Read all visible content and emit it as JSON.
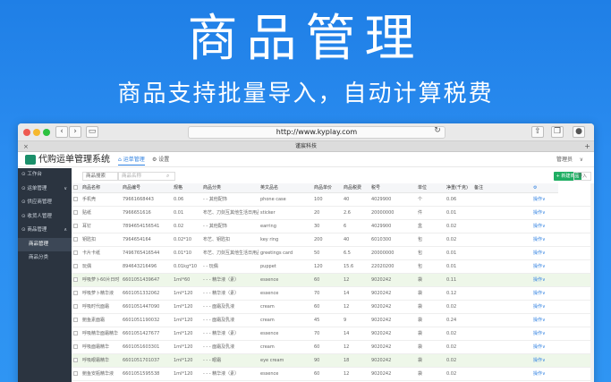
{
  "hero": {
    "title": "商品管理",
    "subtitle": "商品支持批量导入，自动计算税费"
  },
  "browser": {
    "url": "http://www.kyplay.com",
    "tab_title": "谨宸科技"
  },
  "app": {
    "logo_text": "代购运单管理系统",
    "tabs": [
      "运单管理",
      "设置"
    ],
    "user": "管理员"
  },
  "sidebar": {
    "items": [
      {
        "label": "工作台",
        "caret": ""
      },
      {
        "label": "运单管理",
        "caret": "∨"
      },
      {
        "label": "供应商管理",
        "caret": ""
      },
      {
        "label": "收货人管理",
        "caret": ""
      },
      {
        "label": "商品管理",
        "caret": "∧"
      },
      {
        "label": "商品管理",
        "caret": ""
      },
      {
        "label": "商品分类",
        "caret": ""
      }
    ]
  },
  "toolbar": {
    "search_select": "商品搜索",
    "search_placeholder": "商品名称",
    "add_button": "+ 新建商品",
    "import_button": "导入"
  },
  "table": {
    "columns": [
      "商品名称",
      "商品编号",
      "规格",
      "商品分类",
      "英文品名",
      "商品单价",
      "商品税费",
      "税号",
      "单位",
      "净重(千克)",
      "备注",
      "操作"
    ],
    "rows": [
      {
        "hl": false,
        "c": [
          "手机壳",
          "79661668443",
          "0.06",
          "- - 其他配饰",
          "phone case",
          "100",
          "40",
          "4029900",
          "个",
          "0.06",
          "",
          "操作∨"
        ]
      },
      {
        "hl": false,
        "c": [
          "贴纸",
          "7966651616",
          "0.01",
          "布艺、刀剑互其他生活日用品",
          "sticker",
          "20",
          "2.6",
          "20000000",
          "件",
          "0.01",
          "",
          "操作∨"
        ]
      },
      {
        "hl": false,
        "c": [
          "耳钉",
          "7894654156541",
          "0.02",
          "- - 其他配饰",
          "earring",
          "30",
          "6",
          "4029900",
          "盒",
          "0.02",
          "",
          "操作∨"
        ]
      },
      {
        "hl": false,
        "c": [
          "钥匙扣",
          "7964654164",
          "0.02*10",
          "布艺、钥匙扣",
          "key ring",
          "200",
          "40",
          "6010300",
          "包",
          "0.02",
          "",
          "操作∨"
        ]
      },
      {
        "hl": false,
        "c": [
          "卡片卡纸",
          "7496765416544",
          "0.01*10",
          "布艺、刀剑互其他生活日用品",
          "greetings card",
          "50",
          "6.5",
          "20000000",
          "包",
          "0.01",
          "",
          "操作∨"
        ]
      },
      {
        "hl": false,
        "c": [
          "玩偶",
          "894643216496",
          "0.01kg*10",
          "- - 玩偶",
          "puppet",
          "120",
          "15.6",
          "22020200",
          "包",
          "0.01",
          "",
          "操作∨"
        ]
      },
      {
        "hl": true,
        "c": [
          "呼吸萝卜60片日时",
          "6601051439647",
          "1ml*60",
          "- - - 精华液（素）",
          "essence",
          "60",
          "12",
          "9020242",
          "袋",
          "0.11",
          "",
          "操作∨"
        ]
      },
      {
        "hl": false,
        "c": [
          "呼吸萝卜精华液",
          "6601051332062",
          "1ml*120",
          "- - - 精华液（素）",
          "essence",
          "70",
          "14",
          "9020242",
          "袋",
          "0.12",
          "",
          "操作∨"
        ]
      },
      {
        "hl": false,
        "c": [
          "呼吸时代面霜",
          "6601051447090",
          "1ml*120",
          "- - - 面霜及乳液",
          "cream",
          "60",
          "12",
          "9020242",
          "袋",
          "0.02",
          "",
          "操作∨"
        ]
      },
      {
        "hl": false,
        "c": [
          "鲍鱼素面霜",
          "6601051190032",
          "1ml*120",
          "- - - 面霜及乳液",
          "cream",
          "45",
          "9",
          "9020242",
          "袋",
          "0.24",
          "",
          "操作∨"
        ]
      },
      {
        "hl": false,
        "c": [
          "呼吸精华面霜精华",
          "6601051427677",
          "1ml*120",
          "- - - 精华液（素）",
          "essence",
          "70",
          "14",
          "9020242",
          "袋",
          "0.02",
          "",
          "操作∨"
        ]
      },
      {
        "hl": false,
        "c": [
          "呼吸面霜精华",
          "6601051603301",
          "1ml*120",
          "- - - 面霜及乳液",
          "cream",
          "60",
          "12",
          "9020242",
          "袋",
          "0.02",
          "",
          "操作∨"
        ]
      },
      {
        "hl": true,
        "c": [
          "呼吸眼霜精华",
          "6601051701037",
          "1ml*120",
          "- - - 眼霜",
          "eye cream",
          "90",
          "18",
          "9020242",
          "袋",
          "0.02",
          "",
          "操作∨"
        ]
      },
      {
        "hl": false,
        "c": [
          "鲍鱼安瓶精华液",
          "6601051595538",
          "1ml*120",
          "- - - 精华液（素）",
          "essence",
          "60",
          "12",
          "9020242",
          "袋",
          "0.02",
          "",
          "操作∨"
        ]
      }
    ]
  }
}
